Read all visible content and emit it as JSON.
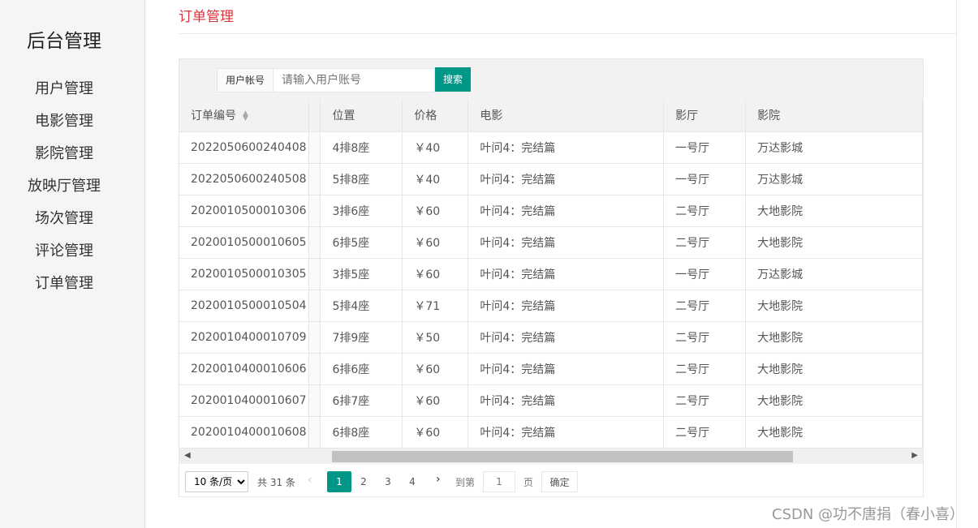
{
  "sidebar": {
    "brand": "后台管理",
    "items": [
      "用户管理",
      "电影管理",
      "影院管理",
      "放映厅管理",
      "场次管理",
      "评论管理",
      "订单管理"
    ]
  },
  "page": {
    "title": "订单管理"
  },
  "search": {
    "label": "用户帐号",
    "placeholder": "请输入用户账号",
    "button": "搜索"
  },
  "table": {
    "columns": [
      "订单编号",
      "位置",
      "价格",
      "电影",
      "影厅",
      "影院"
    ],
    "rows": [
      [
        "2022050600240408",
        "4排8座",
        "￥40",
        "叶问4：完结篇",
        "一号厅",
        "万达影城"
      ],
      [
        "2022050600240508",
        "5排8座",
        "￥40",
        "叶问4：完结篇",
        "一号厅",
        "万达影城"
      ],
      [
        "2020010500010306",
        "3排6座",
        "￥60",
        "叶问4：完结篇",
        "二号厅",
        "大地影院"
      ],
      [
        "2020010500010605",
        "6排5座",
        "￥60",
        "叶问4：完结篇",
        "二号厅",
        "大地影院"
      ],
      [
        "2020010500010305",
        "3排5座",
        "￥60",
        "叶问4：完结篇",
        "一号厅",
        "万达影城"
      ],
      [
        "2020010500010504",
        "5排4座",
        "￥71",
        "叶问4：完结篇",
        "二号厅",
        "大地影院"
      ],
      [
        "2020010400010709",
        "7排9座",
        "￥50",
        "叶问4：完结篇",
        "二号厅",
        "大地影院"
      ],
      [
        "2020010400010606",
        "6排6座",
        "￥60",
        "叶问4：完结篇",
        "二号厅",
        "大地影院"
      ],
      [
        "2020010400010607",
        "6排7座",
        "￥60",
        "叶问4：完结篇",
        "二号厅",
        "大地影院"
      ],
      [
        "2020010400010608",
        "6排8座",
        "￥60",
        "叶问4：完结篇",
        "二号厅",
        "大地影院"
      ]
    ]
  },
  "pager": {
    "page_size": "10 条/页",
    "total": "共 31 条",
    "pages": [
      "1",
      "2",
      "3",
      "4"
    ],
    "active_page": "1",
    "goto_label": "到第",
    "goto_value": "1",
    "page_unit": "页",
    "confirm": "确定"
  },
  "watermark": "CSDN @功不唐捐（春小喜）",
  "colors": {
    "accent": "#009688",
    "title": "#d9363e"
  }
}
